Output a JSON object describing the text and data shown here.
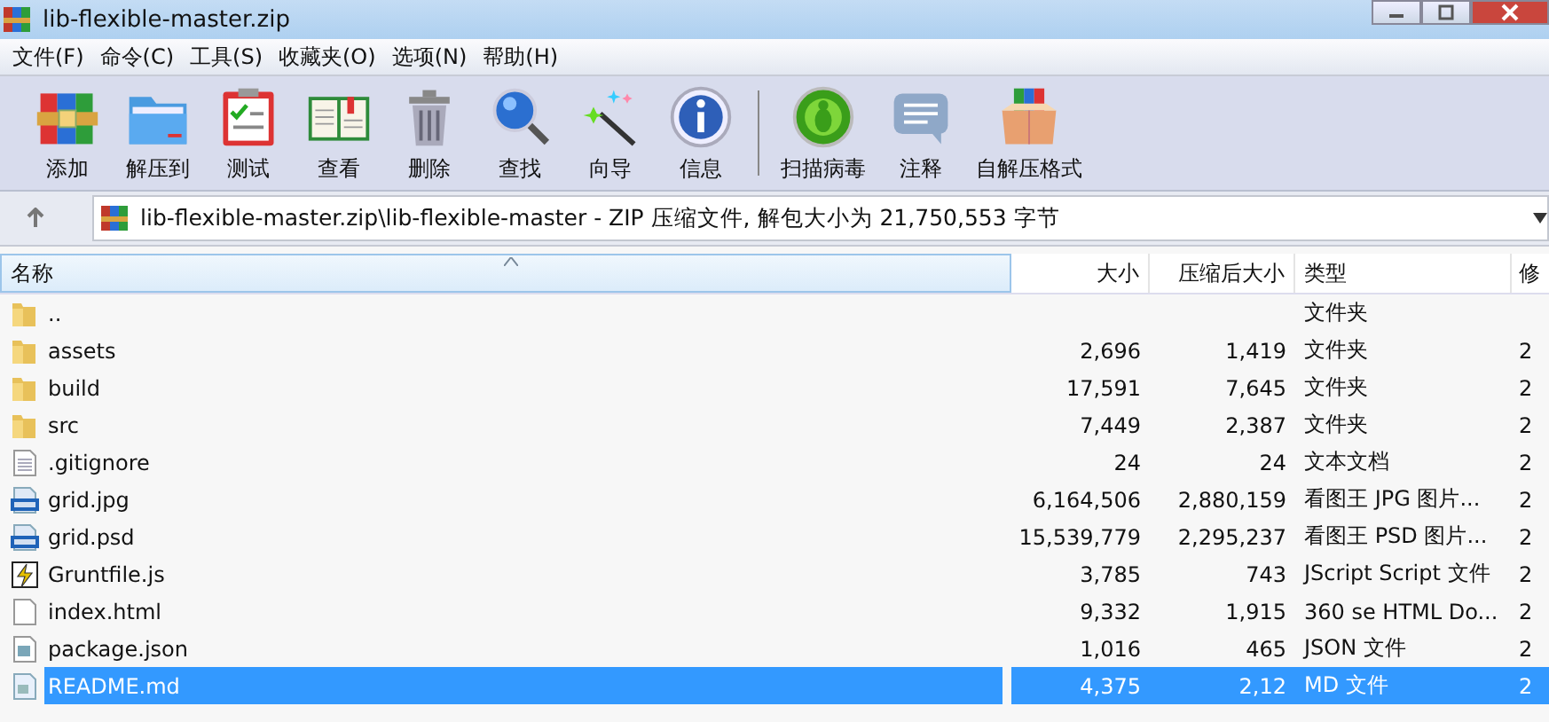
{
  "window": {
    "title": "lib-flexible-master.zip"
  },
  "menu": [
    "文件(F)",
    "命令(C)",
    "工具(S)",
    "收藏夹(O)",
    "选项(N)",
    "帮助(H)"
  ],
  "toolbar": {
    "groups": [
      [
        {
          "kind": "add",
          "label": "添加"
        },
        {
          "kind": "extract",
          "label": "解压到"
        },
        {
          "kind": "test",
          "label": "测试"
        },
        {
          "kind": "view",
          "label": "查看"
        },
        {
          "kind": "delete",
          "label": "删除"
        },
        {
          "kind": "find",
          "label": "查找"
        },
        {
          "kind": "wizard",
          "label": "向导"
        },
        {
          "kind": "info",
          "label": "信息"
        }
      ],
      [
        {
          "kind": "scan",
          "label": "扫描病毒"
        },
        {
          "kind": "comment",
          "label": "注释"
        },
        {
          "kind": "sfx",
          "label": "自解压格式"
        }
      ]
    ]
  },
  "address": {
    "path": "lib-flexible-master.zip\\lib-flexible-master - ZIP 压缩文件, 解包大小为 21,750,553 字节"
  },
  "table": {
    "columns": [
      "名称",
      "大小",
      "压缩后大小",
      "类型",
      "修"
    ],
    "rows": [
      {
        "kind": "folder",
        "name": "..",
        "size": "",
        "packed": "",
        "type": "文件夹",
        "column_5": "",
        "selected": false
      },
      {
        "kind": "folder",
        "name": "assets",
        "size": "2,696",
        "packed": "1,419",
        "type": "文件夹",
        "column_5": "2",
        "selected": false
      },
      {
        "kind": "folder",
        "name": "build",
        "size": "17,591",
        "packed": "7,645",
        "type": "文件夹",
        "column_5": "2",
        "selected": false
      },
      {
        "kind": "folder",
        "name": "src",
        "size": "7,449",
        "packed": "2,387",
        "type": "文件夹",
        "column_5": "2",
        "selected": false
      },
      {
        "kind": "text",
        "name": ".gitignore",
        "size": "24",
        "packed": "24",
        "type": "文本文档",
        "column_5": "2",
        "selected": false
      },
      {
        "kind": "jpg",
        "name": "grid.jpg",
        "size": "6,164,506",
        "packed": "2,880,159",
        "type": "看图王 JPG 图片...",
        "column_5": "2",
        "selected": false
      },
      {
        "kind": "psd",
        "name": "grid.psd",
        "size": "15,539,779",
        "packed": "2,295,237",
        "type": "看图王 PSD 图片...",
        "column_5": "2",
        "selected": false
      },
      {
        "kind": "script",
        "name": "Gruntfile.js",
        "size": "3,785",
        "packed": "743",
        "type": "JScript Script 文件",
        "column_5": "2",
        "selected": false
      },
      {
        "kind": "blank",
        "name": "index.html",
        "size": "9,332",
        "packed": "1,915",
        "type": "360 se HTML Do...",
        "column_5": "2",
        "selected": false
      },
      {
        "kind": "json",
        "name": "package.json",
        "size": "1,016",
        "packed": "465",
        "type": "JSON 文件",
        "column_5": "2",
        "selected": false
      },
      {
        "kind": "md",
        "name": "README.md",
        "size": "4,375",
        "packed": "2,12",
        "type": "MD 文件",
        "column_5": "2",
        "selected": true
      }
    ]
  }
}
